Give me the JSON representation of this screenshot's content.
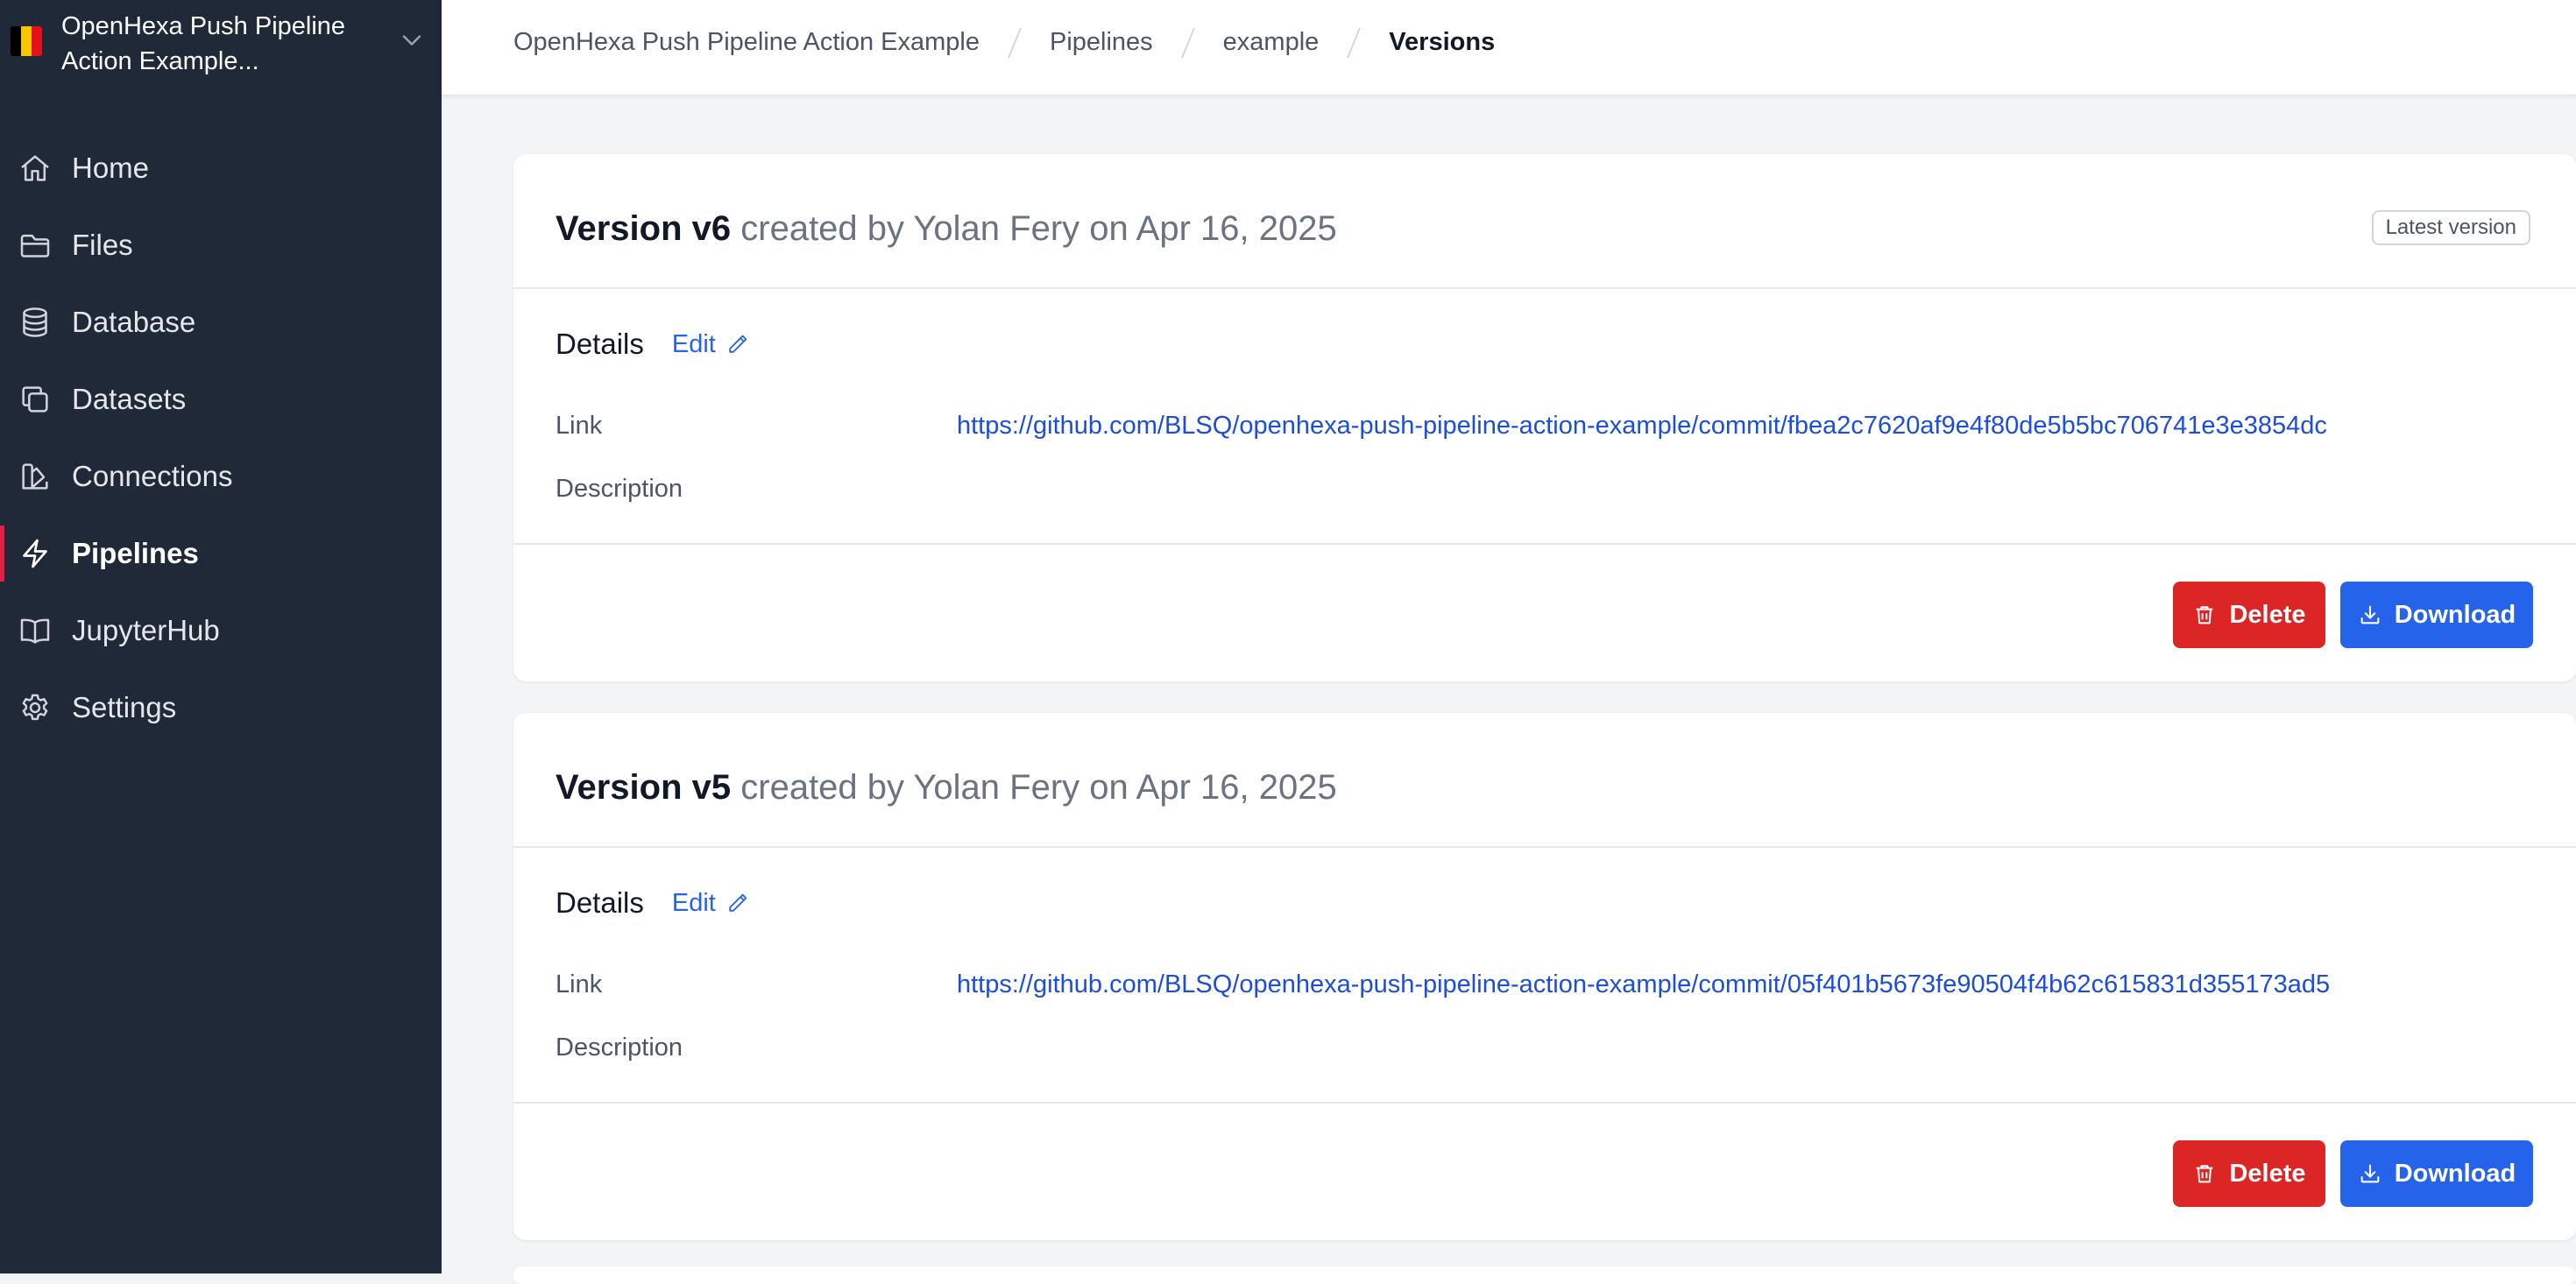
{
  "workspace": {
    "name": "OpenHexa Push Pipeline Action Example...",
    "flag_colors": [
      "#000000",
      "#f7c600",
      "#e4101c"
    ]
  },
  "nav": {
    "items": [
      {
        "label": "Home",
        "icon": "home-icon"
      },
      {
        "label": "Files",
        "icon": "folder-icon"
      },
      {
        "label": "Database",
        "icon": "database-icon"
      },
      {
        "label": "Datasets",
        "icon": "datasets-icon"
      },
      {
        "label": "Connections",
        "icon": "connections-icon"
      },
      {
        "label": "Pipelines",
        "icon": "bolt-icon",
        "active": true
      },
      {
        "label": "JupyterHub",
        "icon": "book-icon"
      },
      {
        "label": "Settings",
        "icon": "gear-icon"
      }
    ]
  },
  "breadcrumb": [
    "OpenHexa Push Pipeline Action Example",
    "Pipelines",
    "example",
    "Versions"
  ],
  "labels": {
    "details": "Details",
    "edit": "Edit",
    "link": "Link",
    "description": "Description",
    "delete": "Delete",
    "download": "Download",
    "latest_version": "Latest version"
  },
  "versions": [
    {
      "name": "Version v6",
      "meta": "created by Yolan Fery on Apr 16, 2025",
      "latest": true,
      "link": "https://github.com/BLSQ/openhexa-push-pipeline-action-example/commit/fbea2c7620af9e4f80de5b5bc706741e3e3854dc",
      "description": ""
    },
    {
      "name": "Version v5",
      "meta": "created by Yolan Fery on Apr 16, 2025",
      "latest": false,
      "link": "https://github.com/BLSQ/openhexa-push-pipeline-action-example/commit/05f401b5673fe90504f4b62c615831d355173ad5",
      "description": ""
    }
  ],
  "colors": {
    "sidebar_bg": "#1f2937",
    "active_indicator": "#e11d48",
    "link": "#1d4ed8",
    "delete": "#dc2626",
    "download": "#2563eb"
  }
}
